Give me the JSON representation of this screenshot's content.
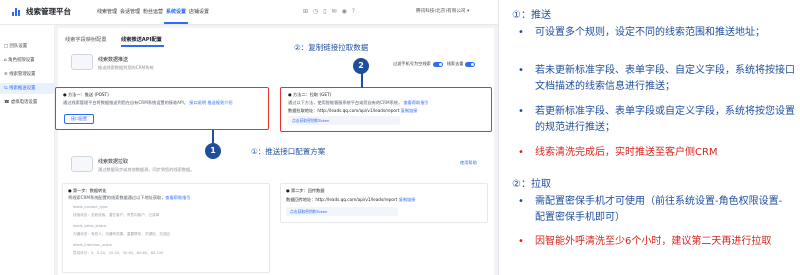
{
  "app": {
    "title": "线索管理平台",
    "nav": [
      "线索管理",
      "会话管理",
      "粉丝运营",
      "系统设置",
      "店铺设置"
    ],
    "active_nav": "系统设置",
    "company": "腾讯科技(北京)有限公司 ▾",
    "brand_color": "#2f6cf6"
  },
  "sidebar": {
    "items": [
      {
        "label": "□ 团队设置"
      },
      {
        "label": "⌂ 角色权限设置"
      },
      {
        "label": "≡ 线索管理设置"
      },
      {
        "label": "⇆ 线索推送设置"
      },
      {
        "label": "☎ 虚拟电话设置"
      }
    ],
    "active_index": 3
  },
  "tabs": [
    "线索字段映射配置",
    "线索推送API配置"
  ],
  "active_tab": "线索推送API配置",
  "push_card": {
    "title": "线索数据推送",
    "subtitle": "推送线索数据到您的CRM系统",
    "toggle1_label": "过滤手机号为空线索",
    "toggle2_label": "线索去重",
    "method1": {
      "title": "● 方法一：推送 (POST)",
      "desc": "通过线索管理平台将数据推送到您在自有CRM系统设置的接收API。",
      "link": "接口说明 推送规则介绍",
      "button": "接口配置"
    },
    "method2": {
      "title": "● 方法二：拉取 (GET)",
      "desc": "通过以下方法，使用智能客服系统平台或您自有的CRM系统，",
      "link": "查看帮助指引",
      "url_label": "数据拉取地址：",
      "url": "http://leads.qq.com/api/v1/leads/report",
      "copy_link": "复制链接",
      "token": "点击获取密钥和Token"
    }
  },
  "pull_card": {
    "title": "线索数据拉取",
    "subtitle": "通过数据同步或其他数据源，同步到您的线索数据。",
    "help": "使用帮助",
    "rule1": {
      "title": "● 第一步：数据转化",
      "desc": "将线索CRM系统配置的线索数据通过以下地址获取，",
      "link": "查看帮助指引",
      "field1": "leads_contact_type",
      "field2": "线索状态：无效线索、潜在客户、有意向客户、已成单",
      "field3": "leads_sales_status",
      "field4": "沟通状态：有效人、沟通有效果、重要联系、关键信、无回应",
      "field5": "leads_intention_score",
      "field6": "意向评分：0、0-20、20-40、40-60、60-80、80-100"
    },
    "rule2": {
      "title": "● 第二步：回传数据",
      "url_label": "数据回传地址：",
      "url": "http://leads.qq.com/api/v1/leads/report",
      "copy_link": "复制链接",
      "token": "点击获取密钥和Token"
    }
  },
  "annotations": {
    "callout_1": "①：推送接口配置方案",
    "callout_2": "②：复制链接拉取数据",
    "marker_1": "1",
    "marker_2": "2",
    "color": "#1f4e9c"
  },
  "notes": {
    "heading_1": "①：推送",
    "bullets_1": [
      {
        "text": "可设置多个规则，设定不同的线索范围和推送地址；",
        "red": false
      },
      {
        "text": "若未更新标准字段、表单字段、自定义字段，系统将按接口文档描述的线索信息进行推送；",
        "red": false
      },
      {
        "text": "若更新标准字段、表单字段或自定义字段，系统将按您设置的规范进行推送；",
        "red": false
      },
      {
        "text": "线索清洗完成后，实时推送至客户侧CRM",
        "red": true
      }
    ],
    "heading_2": "②：拉取",
    "bullets_2": [
      {
        "text": "需配置密保手机才可使用（前往系统设置-角色权限设置-配置密保手机即可）",
        "red": false
      },
      {
        "text": "因智能外呼清洗至少6个小时，建议第二天再进行拉取",
        "red": true
      }
    ],
    "text_color": "#1f4e9c",
    "highlight_color": "#d9261c"
  }
}
